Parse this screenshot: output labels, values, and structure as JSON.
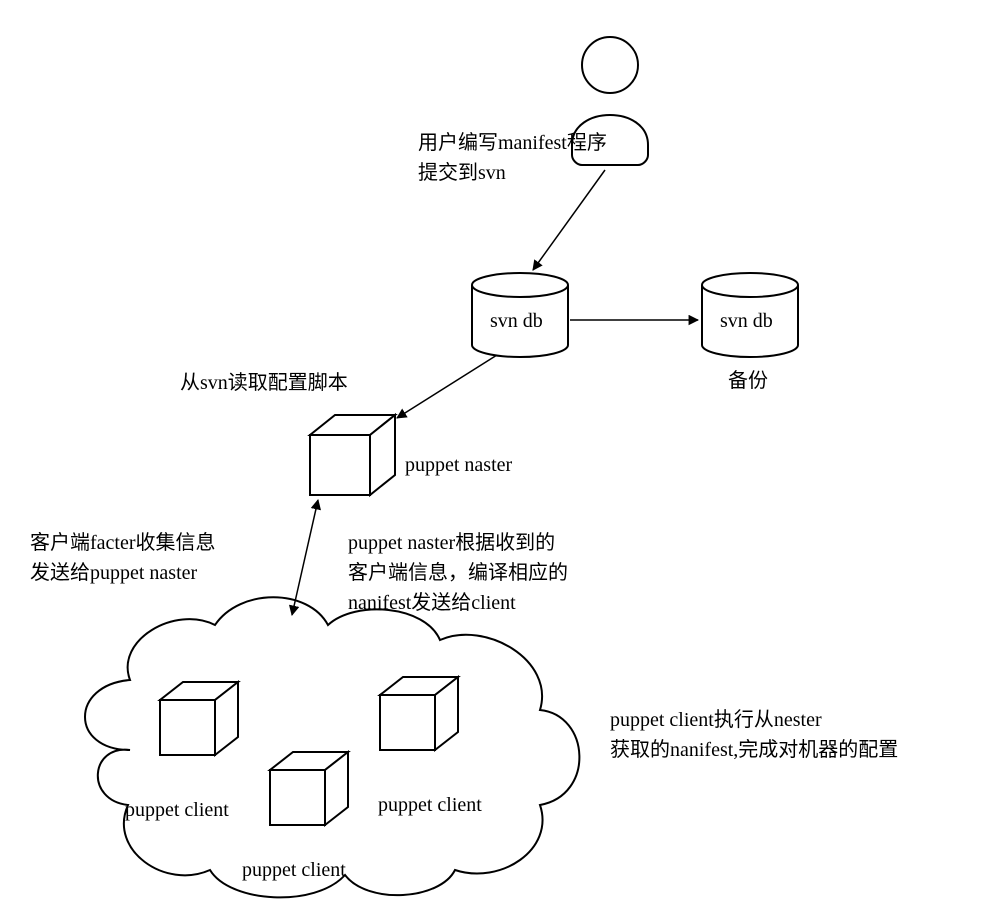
{
  "labels": {
    "user_action": "用户编写manifest程序\n提交到svn",
    "svn_db_1": "svn db",
    "svn_db_2": "svn db",
    "backup": "备份",
    "read_config": "从svn读取配置脚本",
    "puppet_master": "puppet naster",
    "client_facter": "客户端facter收集信息\n发送给puppet naster",
    "master_compile": "puppet naster根据收到的\n客户端信息，编译相应的\nnanifest发送给client",
    "client_exec": "puppet client执行从nester\n获取的nanifest,完成对机器的配置",
    "pc1": "puppet client",
    "pc2": "puppet client",
    "pc3": "puppet client"
  }
}
